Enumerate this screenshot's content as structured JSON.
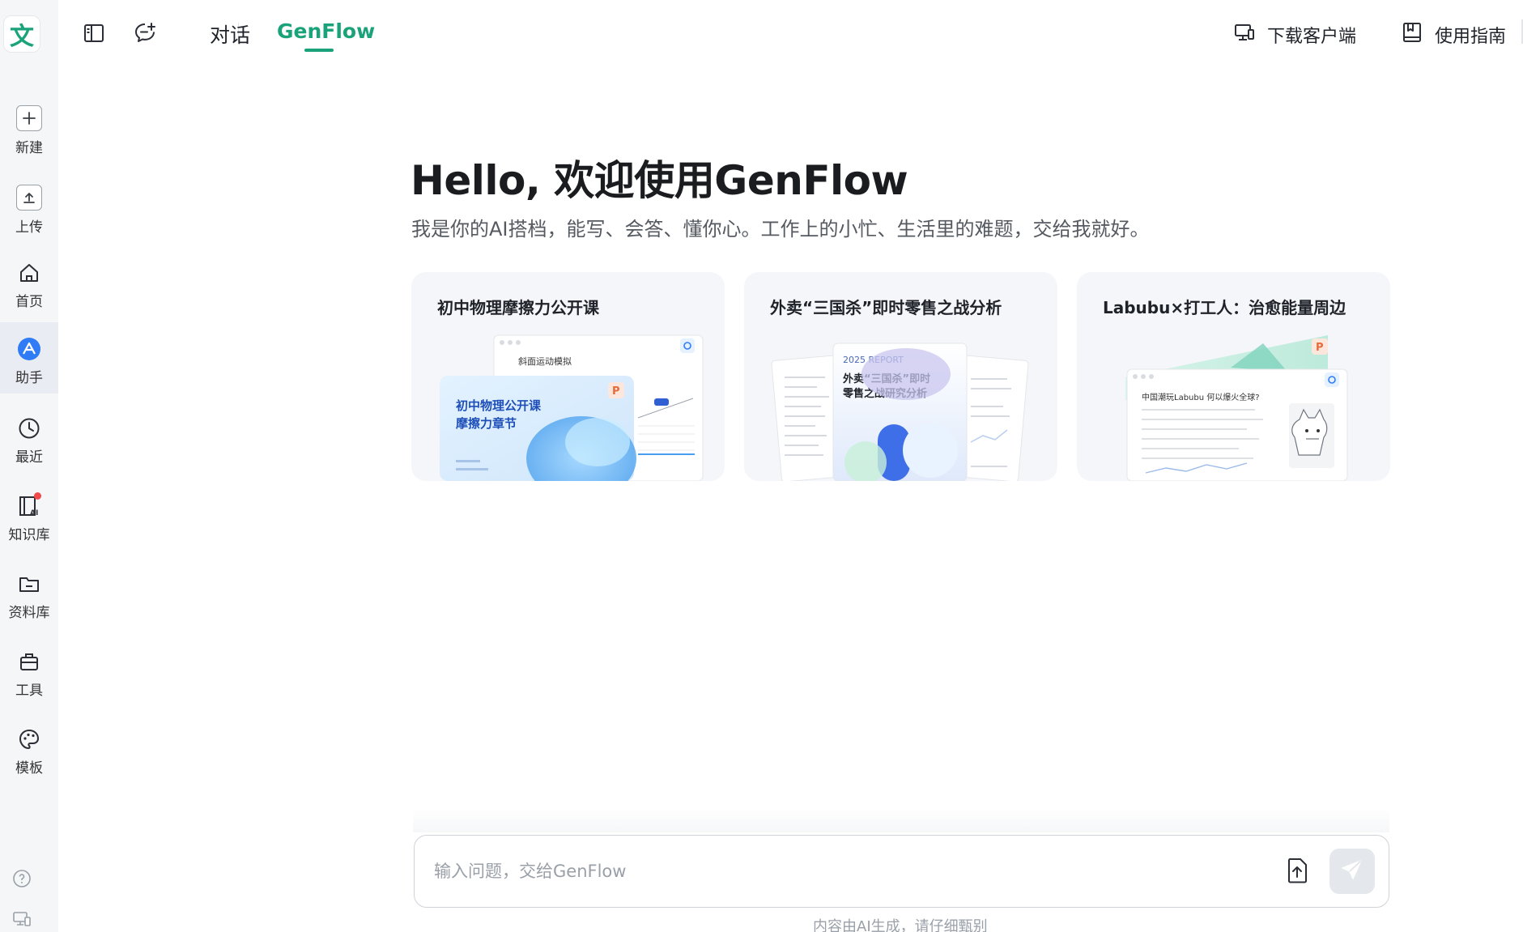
{
  "logo": {
    "glyph": "文"
  },
  "sidebar": {
    "items": [
      {
        "label": "新建",
        "icon": "plus-icon"
      },
      {
        "label": "上传",
        "icon": "upload-icon"
      },
      {
        "label": "首页",
        "icon": "home-icon"
      },
      {
        "label": "助手",
        "icon": "assistant-icon",
        "active": true
      },
      {
        "label": "最近",
        "icon": "clock-icon"
      },
      {
        "label": "知识库",
        "icon": "knowledge-base-icon",
        "badge": true
      },
      {
        "label": "资料库",
        "icon": "folder-icon"
      },
      {
        "label": "工具",
        "icon": "toolbox-icon"
      },
      {
        "label": "模板",
        "icon": "palette-icon"
      }
    ],
    "bottom": [
      {
        "icon": "help-icon"
      },
      {
        "icon": "device-icon"
      }
    ]
  },
  "topbar": {
    "tabs": [
      {
        "label": "对话",
        "active": false
      },
      {
        "label": "GenFlow",
        "active": true
      }
    ],
    "download_label": "下载客户端",
    "guide_label": "使用指南"
  },
  "hero": {
    "title": "Hello, 欢迎使用GenFlow",
    "subtitle": "我是你的AI搭档，能写、会答、懂你心。工作上的小忙、生活里的难题，交给我就好。"
  },
  "cards": [
    {
      "title": "初中物理摩擦力公开课",
      "preview": {
        "panel_title": "斜面运动模拟",
        "slide_title_1": "初中物理公开课",
        "slide_title_2": "摩擦力章节",
        "badge": "P"
      }
    },
    {
      "title": "外卖“三国杀”即时零售之战分析",
      "preview": {
        "report_label": "2025 REPORT",
        "report_title_1": "外卖“三国杀”即时",
        "report_title_2": "零售之战研究分析"
      }
    },
    {
      "title": "Labubu×打工人：治愈能量周边",
      "preview": {
        "doc_title": "中国潮玩Labubu  何以爆火全球?",
        "badge": "P"
      }
    }
  ],
  "input": {
    "placeholder": "输入问题，交给GenFlow",
    "value": ""
  },
  "disclaimer": "内容由AI生成，请仔细甄别",
  "colors": {
    "accent": "#1aa37a",
    "assistant": "#2f7cf6",
    "badge": "#f04a4a"
  }
}
